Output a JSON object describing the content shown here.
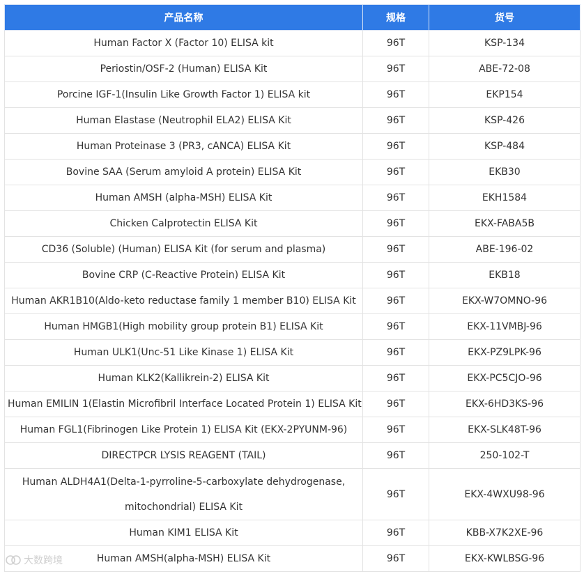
{
  "table": {
    "headers": [
      "产品名称",
      "规格",
      "货号"
    ],
    "rows": [
      [
        "Human Factor X (Factor 10) ELISA kit",
        "96T",
        "KSP-134"
      ],
      [
        "Periostin/OSF-2 (Human) ELISA Kit",
        "96T",
        "ABE-72-08"
      ],
      [
        "Porcine IGF-1(Insulin Like Growth Factor 1) ELISA kit",
        "96T",
        "EKP154"
      ],
      [
        "Human Elastase (Neutrophil ELA2) ELISA Kit",
        "96T",
        "KSP-426"
      ],
      [
        "Human Proteinase 3 (PR3, cANCA) ELISA Kit",
        "96T",
        "KSP-484"
      ],
      [
        "Bovine SAA (Serum amyloid A protein) ELISA Kit",
        "96T",
        "EKB30"
      ],
      [
        "Human AMSH (alpha-MSH) ELISA Kit",
        "96T",
        "EKH1584"
      ],
      [
        "Chicken Calprotectin ELISA Kit",
        "96T",
        "EKX-FABA5B"
      ],
      [
        "CD36 (Soluble) (Human) ELISA Kit (for serum and plasma)",
        "96T",
        "ABE-196-02"
      ],
      [
        "Bovine CRP (C-Reactive Protein) ELISA Kit",
        "96T",
        "EKB18"
      ],
      [
        "Human AKR1B10(Aldo-keto reductase family 1 member B10) ELISA Kit",
        "96T",
        "EKX-W7OMNO-96"
      ],
      [
        "Human HMGB1(High mobility group protein B1) ELISA Kit",
        "96T",
        "EKX-11VMBJ-96"
      ],
      [
        "Human ULK1(Unc-51 Like Kinase 1) ELISA Kit",
        "96T",
        "EKX-PZ9LPK-96"
      ],
      [
        "Human KLK2(Kallikrein-2) ELISA Kit",
        "96T",
        "EKX-PC5CJO-96"
      ],
      [
        "Human EMILIN 1(Elastin Microfibril Interface Located Protein 1) ELISA Kit",
        "96T",
        "EKX-6HD3KS-96"
      ],
      [
        "Human FGL1(Fibrinogen Like Protein 1) ELISA Kit (EKX-2PYUNM-96)",
        "96T",
        "EKX-SLK48T-96"
      ],
      [
        "DIRECTPCR LYSIS REAGENT (TAIL)",
        "96T",
        "250-102-T"
      ],
      [
        "Human ALDH4A1(Delta-1-pyrroline-5-carboxylate dehydrogenase, mitochondrial) ELISA Kit",
        "96T",
        "EKX-4WXU98-96"
      ],
      [
        "Human KIM1 ELISA Kit",
        "96T",
        "KBB-X7K2XE-96"
      ],
      [
        "Human AMSH(alpha-MSH) ELISA Kit",
        "96T",
        "EKX-KWLBSG-96"
      ]
    ]
  },
  "watermark": {
    "text": "大数跨境",
    "icon": "brand-logo-icon"
  },
  "colors": {
    "header_bg": "#2f7ae5",
    "header_text": "#ffffff",
    "body_text": "#333333",
    "border": "#e3e3e3"
  }
}
